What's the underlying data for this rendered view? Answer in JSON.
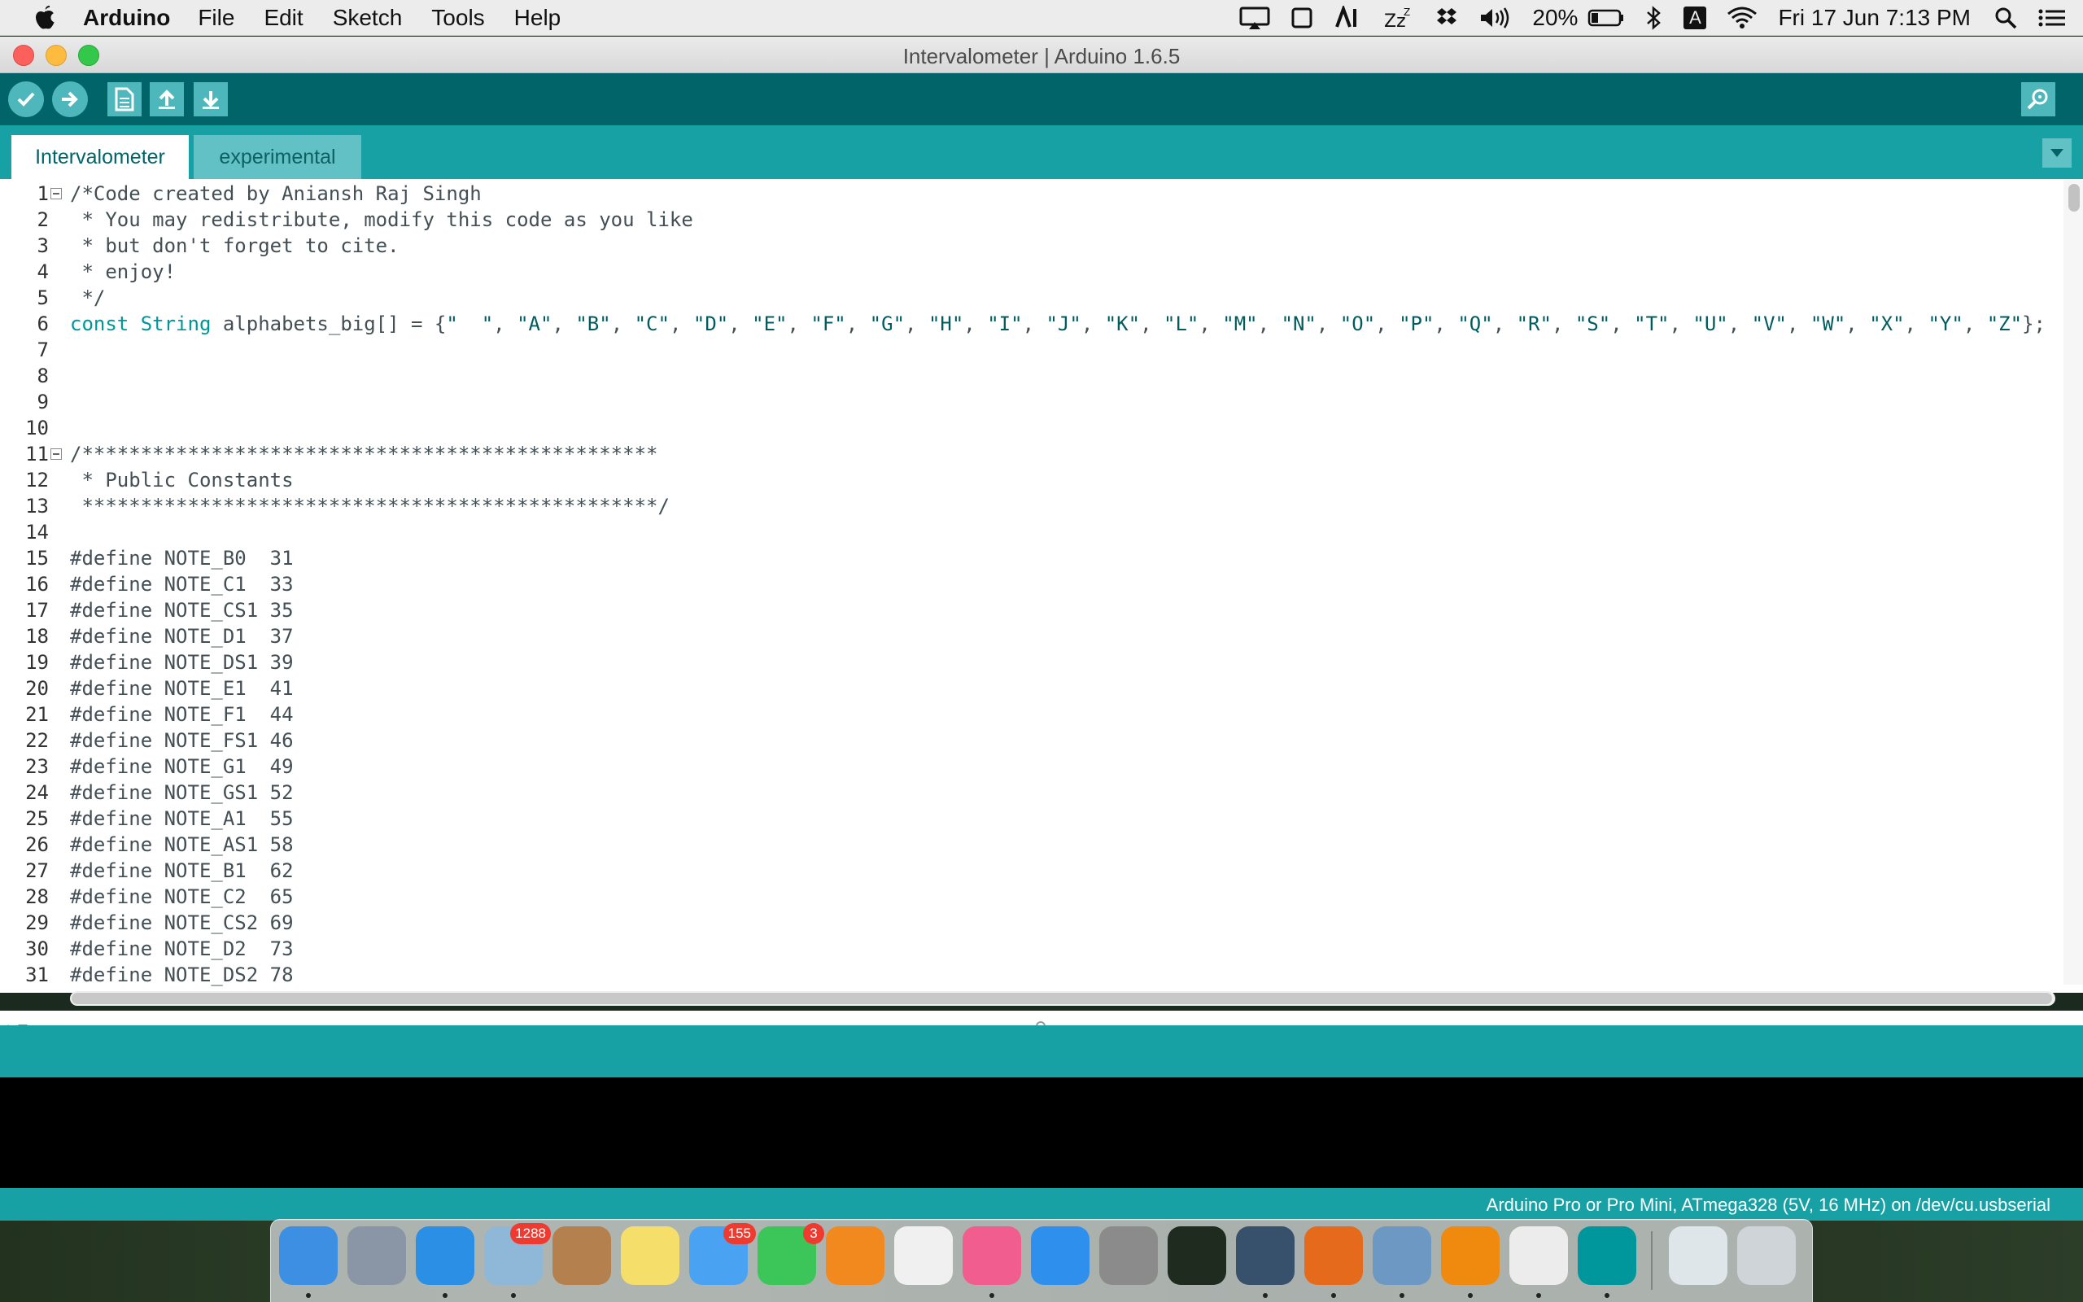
{
  "menubar": {
    "app_name": "Arduino",
    "items": [
      "File",
      "Edit",
      "Sketch",
      "Tools",
      "Help"
    ],
    "battery_percent": "20%",
    "clock": "Fri 17 Jun  7:13 PM",
    "input_source": "A",
    "icons": [
      "airplay-icon",
      "window-icon",
      "text-input-icon",
      "sleep-icon",
      "dropbox-icon",
      "volume-icon",
      "battery-icon",
      "bluetooth-icon",
      "wifi-icon",
      "spotlight-icon",
      "notification-center-icon"
    ]
  },
  "window": {
    "title": "Intervalometer | Arduino 1.6.5"
  },
  "toolbar": {
    "buttons": [
      "verify",
      "upload",
      "new",
      "open",
      "save"
    ],
    "serial_monitor": "serial-monitor"
  },
  "tabs": [
    {
      "label": "Intervalometer",
      "active": true
    },
    {
      "label": "experimental",
      "active": false
    }
  ],
  "editor": {
    "lines": [
      {
        "n": "1",
        "text": "/*Code created by Aniansh Raj Singh",
        "fold": true
      },
      {
        "n": "2",
        "text": " * You may redistribute, modify this code as you like"
      },
      {
        "n": "3",
        "text": " * but don't forget to cite."
      },
      {
        "n": "4",
        "text": " * enjoy!"
      },
      {
        "n": "5",
        "text": " */"
      },
      {
        "n": "6",
        "kw": "const String",
        "text": " alphabets_big[] = {\"  \", \"A\", \"B\", \"C\", \"D\", \"E\", \"F\", \"G\", \"H\", \"I\", \"J\", \"K\", \"L\", \"M\", \"N\", \"O\", \"P\", \"Q\", \"R\", \"S\", \"T\", \"U\", \"V\", \"W\", \"X\", \"Y\", \"Z\"};"
      },
      {
        "n": "7",
        "text": ""
      },
      {
        "n": "8",
        "text": ""
      },
      {
        "n": "9",
        "text": ""
      },
      {
        "n": "10",
        "text": ""
      },
      {
        "n": "11",
        "text": "/*************************************************",
        "fold": true
      },
      {
        "n": "12",
        "text": " * Public Constants"
      },
      {
        "n": "13",
        "text": " *************************************************/"
      },
      {
        "n": "14",
        "text": ""
      },
      {
        "n": "15",
        "text": "#define NOTE_B0  31"
      },
      {
        "n": "16",
        "text": "#define NOTE_C1  33"
      },
      {
        "n": "17",
        "text": "#define NOTE_CS1 35"
      },
      {
        "n": "18",
        "text": "#define NOTE_D1  37"
      },
      {
        "n": "19",
        "text": "#define NOTE_DS1 39"
      },
      {
        "n": "20",
        "text": "#define NOTE_E1  41"
      },
      {
        "n": "21",
        "text": "#define NOTE_F1  44"
      },
      {
        "n": "22",
        "text": "#define NOTE_FS1 46"
      },
      {
        "n": "23",
        "text": "#define NOTE_G1  49"
      },
      {
        "n": "24",
        "text": "#define NOTE_GS1 52"
      },
      {
        "n": "25",
        "text": "#define NOTE_A1  55"
      },
      {
        "n": "26",
        "text": "#define NOTE_AS1 58"
      },
      {
        "n": "27",
        "text": "#define NOTE_B1  62"
      },
      {
        "n": "28",
        "text": "#define NOTE_C2  65"
      },
      {
        "n": "29",
        "text": "#define NOTE_CS2 69"
      },
      {
        "n": "30",
        "text": "#define NOTE_D2  73"
      },
      {
        "n": "31",
        "text": "#define NOTE_DS2 78"
      }
    ]
  },
  "status_bar": {
    "board": "Arduino Pro or Pro Mini, ATmega328 (5V, 16 MHz) on /dev/cu.usbserial"
  },
  "dock": {
    "apps": [
      {
        "name": "finder",
        "color": "#3d8fe3",
        "running": true
      },
      {
        "name": "launchpad",
        "color": "#8a96a6",
        "running": false
      },
      {
        "name": "safari",
        "color": "#2b8fe6",
        "running": true
      },
      {
        "name": "mail",
        "color": "#8fb7d8",
        "running": true,
        "badge": "1288"
      },
      {
        "name": "contacts",
        "color": "#b4814e",
        "running": false
      },
      {
        "name": "notes",
        "color": "#f5df6a",
        "running": false
      },
      {
        "name": "messages",
        "color": "#49a3f2",
        "running": false,
        "badge": "155"
      },
      {
        "name": "facetime",
        "color": "#3cc65a",
        "running": false,
        "badge": "3"
      },
      {
        "name": "ibooks",
        "color": "#f2891f",
        "running": false
      },
      {
        "name": "photos",
        "color": "#f0f0f0",
        "running": false
      },
      {
        "name": "itunes",
        "color": "#f05d8e",
        "running": true
      },
      {
        "name": "app-store",
        "color": "#2e8fec",
        "running": false
      },
      {
        "name": "system-preferences",
        "color": "#8b8b8b",
        "running": false
      },
      {
        "name": "activity-monitor",
        "color": "#1f2b1f",
        "running": false
      },
      {
        "name": "quicktime",
        "color": "#37506b",
        "running": true
      },
      {
        "name": "firefox",
        "color": "#e66a1c",
        "running": true
      },
      {
        "name": "preview",
        "color": "#6e98c4",
        "running": true
      },
      {
        "name": "vlc",
        "color": "#f08a0e",
        "running": true
      },
      {
        "name": "textedit",
        "color": "#ececec",
        "running": true
      },
      {
        "name": "arduino",
        "color": "#00979c",
        "running": true
      }
    ],
    "extras": [
      {
        "name": "downloads-stack",
        "color": "#dfe6ea"
      },
      {
        "name": "trash",
        "color": "#cfd4d8"
      }
    ]
  }
}
